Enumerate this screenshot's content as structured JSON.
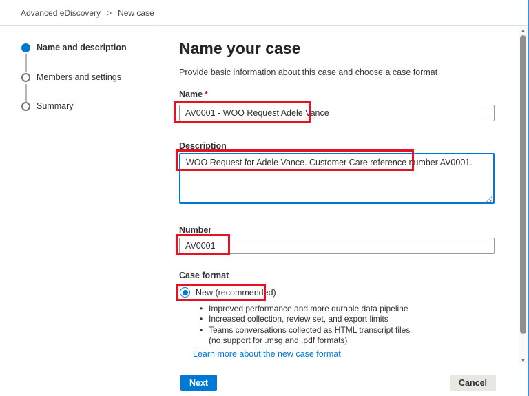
{
  "breadcrumb": {
    "items": [
      "Advanced eDiscovery",
      "New case"
    ],
    "separator": ">"
  },
  "stepper": {
    "steps": [
      {
        "label": "Name and description",
        "state": "active"
      },
      {
        "label": "Members and settings",
        "state": "pending"
      },
      {
        "label": "Summary",
        "state": "pending"
      }
    ]
  },
  "main": {
    "title": "Name your case",
    "subtitle": "Provide basic information about this case and choose a case format",
    "fields": {
      "name": {
        "label": "Name",
        "required_mark": "*",
        "value": "AV0001 - WOO Request Adele Vance"
      },
      "description": {
        "label": "Description",
        "value": "WOO Request for Adele Vance. Customer Care reference number AV0001."
      },
      "number": {
        "label": "Number",
        "value": "AV0001"
      }
    },
    "case_format": {
      "label": "Case format",
      "selected_option": "New (recommended)",
      "bullets": [
        "Improved performance and more durable data pipeline",
        "Increased collection, review set, and export limits",
        "Teams conversations collected as HTML transcript files"
      ],
      "bullet_note": "(no support for .msg and .pdf formats)",
      "learn_more": "Learn more about the new case format"
    }
  },
  "footer": {
    "next": "Next",
    "cancel": "Cancel"
  },
  "icons": {
    "scroll_up": "▲",
    "scroll_down": "▼"
  },
  "colors": {
    "accent": "#0078d4",
    "annotation_red": "#e81123",
    "link": "#0078d4",
    "required_mark": "#a4262c",
    "divider": "#e1dfdd"
  }
}
